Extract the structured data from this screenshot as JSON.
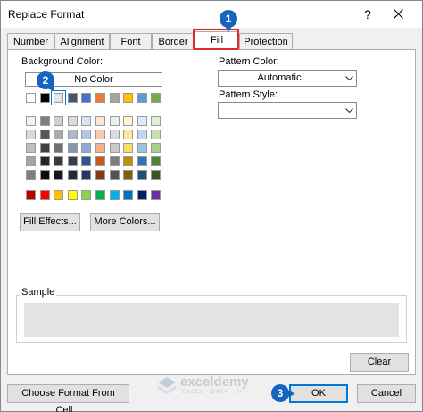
{
  "window": {
    "title": "Replace Format",
    "help_label": "?"
  },
  "tabs": [
    {
      "label": "Number"
    },
    {
      "label": "Alignment"
    },
    {
      "label": "Font"
    },
    {
      "label": "Border"
    },
    {
      "label": "Fill",
      "selected": true
    },
    {
      "label": "Protection"
    }
  ],
  "fill": {
    "background_color_label": "Background Color:",
    "no_color_label": "No Color",
    "pattern_color_label": "Pattern Color:",
    "pattern_color_value": "Automatic",
    "pattern_style_label": "Pattern Style:",
    "pattern_style_value": "",
    "fill_effects_label": "Fill Effects...",
    "more_colors_label": "More Colors...",
    "sample_label": "Sample",
    "sample_color": "#e3e3e3"
  },
  "palette": {
    "theme_top": [
      "#ffffff",
      "#000000",
      "#e7e6e6",
      "#44546a",
      "#4472c4",
      "#ed7d31",
      "#a5a5a5",
      "#ffc000",
      "#5b9bd5",
      "#70ad47"
    ],
    "theme_tints": [
      [
        "#f2f2f2",
        "#7f7f7f",
        "#d0cece",
        "#d6dce4",
        "#d9e2f3",
        "#fbe5d5",
        "#ededed",
        "#fff2cc",
        "#deebf6",
        "#e2efd9"
      ],
      [
        "#d8d8d8",
        "#595959",
        "#aeaaaa",
        "#adb9ca",
        "#b4c6e7",
        "#f7cbac",
        "#dbdbdb",
        "#fee599",
        "#bdd7ee",
        "#c5e0b3"
      ],
      [
        "#bfbfbf",
        "#3f3f3f",
        "#757070",
        "#8496b0",
        "#8eaadb",
        "#f4b183",
        "#c9c9c9",
        "#ffd965",
        "#9cc3e5",
        "#a8d08d"
      ],
      [
        "#a5a5a5",
        "#262626",
        "#3a3838",
        "#323f4f",
        "#2f5496",
        "#c55a11",
        "#7b7b7b",
        "#bf9000",
        "#2e75b5",
        "#538135"
      ],
      [
        "#7f7f7f",
        "#0c0c0c",
        "#171616",
        "#222a35",
        "#1f3864",
        "#833c0b",
        "#525252",
        "#7f6000",
        "#1e4e79",
        "#375623"
      ]
    ],
    "standard": [
      "#c00000",
      "#ff0000",
      "#ffc000",
      "#ffff00",
      "#92d050",
      "#00b050",
      "#00b0f0",
      "#0070c0",
      "#002060",
      "#7030a0"
    ],
    "selected_index": 2
  },
  "buttons": {
    "clear_label": "Clear",
    "choose_format_label": "Choose Format From Cell...",
    "ok_label": "OK",
    "cancel_label": "Cancel"
  },
  "callouts": [
    "1",
    "2",
    "3"
  ],
  "watermark": {
    "name": "exceldemy",
    "tagline": "EXCEL · DATA · BI"
  },
  "colors": {
    "highlight": "#e02a2a",
    "accent": "#0078d7",
    "callout": "#1565c0"
  }
}
